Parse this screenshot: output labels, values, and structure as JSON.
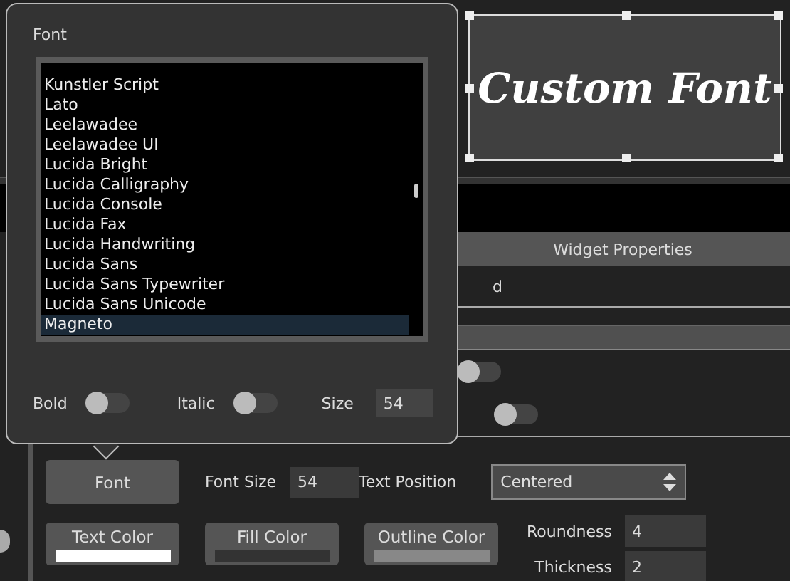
{
  "preview": {
    "text": "Custom Font"
  },
  "panel": {
    "header": "Widget Properties",
    "partial_text": "d",
    "toggles": [
      {
        "on": false
      },
      {
        "on": false
      }
    ]
  },
  "font_popover": {
    "title": "Font",
    "fonts": [
      {
        "name": "Kunstler Script",
        "selected": false
      },
      {
        "name": "Lato",
        "selected": false
      },
      {
        "name": "Leelawadee",
        "selected": false
      },
      {
        "name": "Leelawadee UI",
        "selected": false
      },
      {
        "name": "Lucida Bright",
        "selected": false
      },
      {
        "name": "Lucida Calligraphy",
        "selected": false
      },
      {
        "name": "Lucida Console",
        "selected": false
      },
      {
        "name": "Lucida Fax",
        "selected": false
      },
      {
        "name": "Lucida Handwriting",
        "selected": false
      },
      {
        "name": "Lucida Sans",
        "selected": false
      },
      {
        "name": "Lucida Sans Typewriter",
        "selected": false
      },
      {
        "name": "Lucida Sans Unicode",
        "selected": false
      },
      {
        "name": "Magneto",
        "selected": true
      }
    ],
    "bold": {
      "label": "Bold",
      "on": false
    },
    "italic": {
      "label": "Italic",
      "on": false
    },
    "size": {
      "label": "Size",
      "value": "54"
    }
  },
  "controls": {
    "font_button": "Font",
    "font_size": {
      "label": "Font Size",
      "value": "54"
    },
    "text_position": {
      "label": "Text Position",
      "value": "Centered"
    },
    "color_buttons": [
      {
        "label": "Text Color",
        "color": "#ffffff"
      },
      {
        "label": "Fill Color",
        "color": "#333333"
      },
      {
        "label": "Outline Color",
        "color": "#888888"
      }
    ],
    "roundness": {
      "label": "Roundness",
      "value": "4"
    },
    "thickness": {
      "label": "Thickness",
      "value": "2"
    }
  }
}
